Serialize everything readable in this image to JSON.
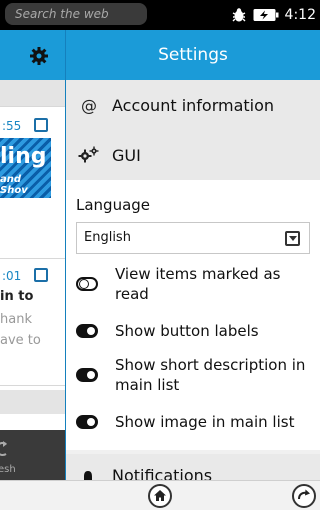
{
  "status_bar": {
    "search_placeholder": "Search the web",
    "time": "4:12",
    "icons": [
      "bug-icon",
      "battery-charging-icon"
    ]
  },
  "background_panel": {
    "items": [
      {
        "time_fragment": ":55",
        "banner_line1": "ling",
        "banner_line2": "and Shov"
      },
      {
        "time_fragment": ":01",
        "title_fragment": "in to",
        "text_line1": "hank",
        "text_line2": "ave to"
      }
    ],
    "footer_label": "esh"
  },
  "settings": {
    "title": "Settings",
    "menu": [
      {
        "icon": "at-sign-icon",
        "glyph": "@",
        "label": "Account information"
      },
      {
        "icon": "gears-icon",
        "label": "GUI"
      }
    ],
    "language": {
      "label": "Language",
      "selected": "English"
    },
    "options": [
      {
        "label": "View items marked as read",
        "enabled": false
      },
      {
        "label": "Show button labels",
        "enabled": true
      },
      {
        "label": "Show short description in main list",
        "enabled": true
      },
      {
        "label": "Show image in main list",
        "enabled": true
      }
    ],
    "notifications": {
      "icon": "bell-icon",
      "label": "Notifications"
    }
  },
  "bottom_bar": {
    "icons": [
      "home-icon",
      "reload-icon"
    ]
  },
  "colors": {
    "accent": "#1b9bd8",
    "status_bar": "#000000",
    "menu_row_bg": "#e9e9e9",
    "section_bg": "#ffffff"
  }
}
